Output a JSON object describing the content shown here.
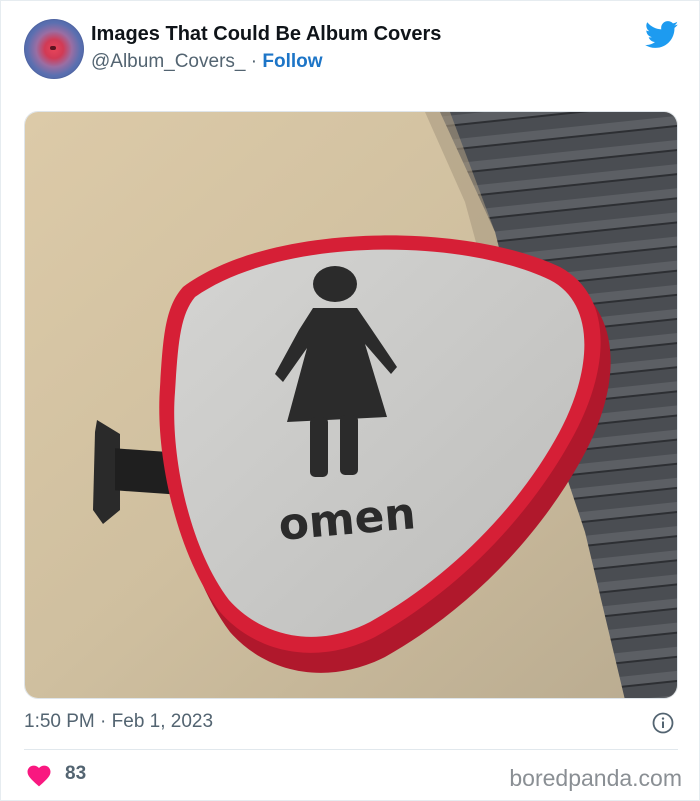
{
  "tweet": {
    "author_name": "Images That Could Be Album Covers",
    "author_handle": "@Album_Covers_",
    "separator": " · ",
    "follow_label": "Follow",
    "timestamp": "1:50 PM · Feb 1, 2023",
    "like_count": "83"
  },
  "image": {
    "sign_text": "omen",
    "sign_rim_color": "#d61f36",
    "sign_face_color": "#c9c9c7"
  },
  "icons": {
    "brand": "twitter-bird-icon",
    "info": "info-icon",
    "like": "heart-icon"
  },
  "colors": {
    "twitter_blue": "#1d9bf0",
    "follow_link": "#1d75c7",
    "heart": "#f91880",
    "muted_text": "#536471"
  },
  "watermark": "boredpanda.com"
}
